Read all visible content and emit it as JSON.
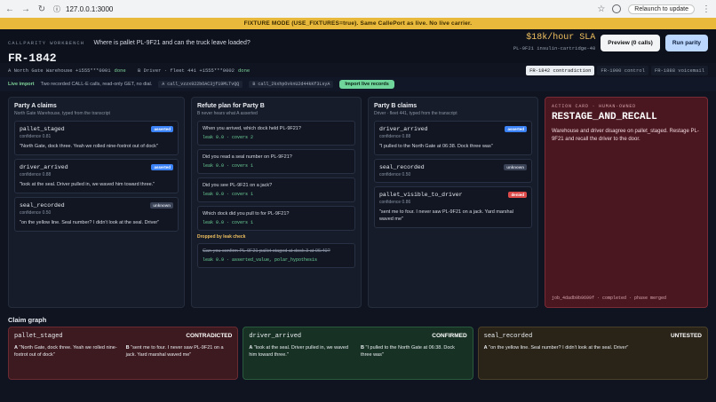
{
  "browser": {
    "url": "127.0.0.1:3000",
    "relaunch": "Relaunch to update"
  },
  "banner": "FIXTURE MODE (USE_FIXTURES=true). Same CallePort as live. No live carrier.",
  "header": {
    "brand": "CALLPARITY WORKBENCH",
    "question": "Where is pallet PL-9F21 and can the truck leave loaded?",
    "case_id": "FR-1842",
    "sla_rate": "$18k/hour SLA",
    "sla_part": "PL-9F21 insulin-cartridge-40",
    "preview_btn": "Preview (0 calls)",
    "run_btn": "Run parity"
  },
  "subbar": {
    "party_a": "A North Gate Warehouse +1555***0001",
    "party_a_status": "done",
    "party_b": "B Driver · fleet 441 +1555***0002",
    "party_b_status": "done",
    "tabs": [
      "FR-1842 contradiction",
      "FR-1900 control",
      "FR-1888 voicemail"
    ]
  },
  "import": {
    "label": "Live import",
    "desc": "Two recorded CALL-E calls, read-only GET, no dial.",
    "call_a": "A call_vzzx922bOAC3jf19MLTvQQ",
    "call_b": "B call_2kxhpOvknU2d44kKf3LsyA",
    "button": "Import live records"
  },
  "party_a": {
    "title": "Party A claims",
    "sub": "North Gate Warehouse, typed from the transcript",
    "claims": [
      {
        "key": "pallet_staged",
        "badge": "asserted",
        "conf": "confidence 0.81",
        "quote": "\"North Gate, dock three. Yeah we rolled nine-foxtrot out of dock\""
      },
      {
        "key": "driver_arrived",
        "badge": "asserted",
        "conf": "confidence 0.88",
        "quote": "\"look at the seal. Driver pulled in, we waved him toward three.\""
      },
      {
        "key": "seal_recorded",
        "badge": "unknown",
        "conf": "confidence 0.50",
        "quote": "\"on the yellow line. Seal number? I didn't look at the seal. Driver\""
      }
    ]
  },
  "refute": {
    "title": "Refute plan for Party B",
    "sub": "B never hears what A asserted",
    "questions": [
      {
        "text": "When you arrived, which dock held PL-9F21?",
        "leak": "leak 0.0 · covers 2"
      },
      {
        "text": "Did you read a seal number on PL-9F21?",
        "leak": "leak 0.0 · covers 1"
      },
      {
        "text": "Did you see PL-9F21 on a jack?",
        "leak": "leak 0.0 · covers 1"
      },
      {
        "text": "Which dock did you pull to for PL-9F21?",
        "leak": "leak 0.0 · covers 1"
      }
    ],
    "dropped_label": "Dropped by leak check",
    "dropped": {
      "text": "Can you confirm PL-9F21 pallet staged at dock 3 at 06:40?",
      "leak": "leak 0.9 · asserted_value, polar_hypothesis"
    }
  },
  "party_b": {
    "title": "Party B claims",
    "sub": "Driver · fleet 441, typed from the transcript",
    "claims": [
      {
        "key": "driver_arrived",
        "badge": "asserted",
        "conf": "confidence 0.88",
        "quote": "\"I pulled to the North Gate at 06:38. Dock three was\""
      },
      {
        "key": "seal_recorded",
        "badge": "unknown",
        "conf": "confidence 0.50",
        "quote": ""
      },
      {
        "key": "pallet_visible_to_driver",
        "badge": "denied",
        "conf": "confidence 0.86",
        "quote": "\"sent me to four. I never saw PL-9F21 on a jack. Yard marshal waved me\""
      }
    ]
  },
  "action": {
    "label": "ACTION CARD · HUMAN-OWNED",
    "title": "RESTAGE_AND_RECALL",
    "desc": "Warehouse and driver disagree on pallet_staged. Restage PL-9F21 and recall the driver to the door.",
    "foot": "job_4dadb9b9699f · completed · phase merged"
  },
  "graph": {
    "title": "Claim graph",
    "cards": [
      {
        "key": "pallet_staged",
        "status": "CONTRADICTED",
        "a": "\"North Gate, dock three. Yeah we rolled nine-foxtrot out of dock\"",
        "b": "\"sent me to four. I never saw PL-9F21 on a jack. Yard marshal waved me\""
      },
      {
        "key": "driver_arrived",
        "status": "CONFIRMED",
        "a": "\"look at the seal. Driver pulled in, we waved him toward three.\"",
        "b": "\"I pulled to the North Gate at 06:38. Dock three was\""
      },
      {
        "key": "seal_recorded",
        "status": "UNTESTED",
        "a": "\"on the yellow line. Seal number? I didn't look at the seal. Driver\"",
        "b": ""
      }
    ]
  },
  "colors": {
    "accent": "#e8b93a",
    "asserted": "#3b82f6",
    "denied": "#dc4a4a",
    "confirmed": "#6fd59a"
  }
}
